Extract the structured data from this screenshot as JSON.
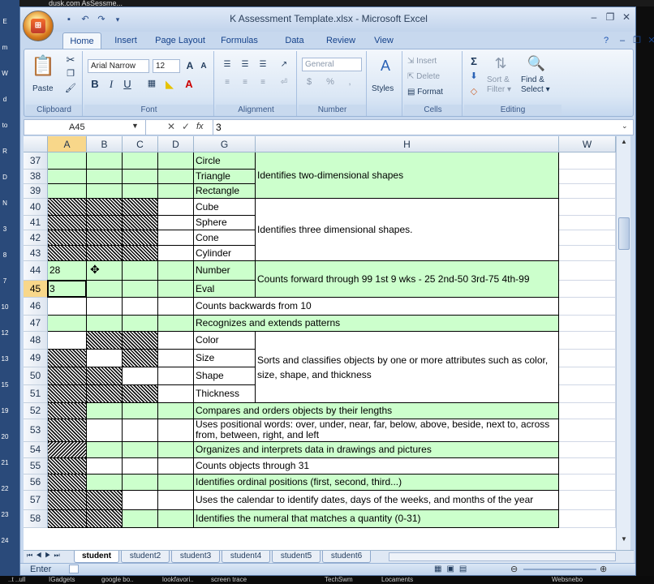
{
  "desktop": {
    "top_text": "dusk.com   AsSessme...",
    "left_labels": [
      "E",
      "m",
      "W",
      "d",
      "to",
      "R",
      "D",
      "N",
      "3",
      "8",
      "7",
      "10",
      "12",
      "13",
      "15",
      "19",
      "20",
      "21",
      "22",
      "23",
      "24"
    ],
    "bottom_items": [
      "..t ..ull",
      "IGadgets",
      "google bo..",
      "lookfavori..",
      "screen trace",
      "TechSwm",
      "Locaments",
      "Websnebo"
    ]
  },
  "window": {
    "title": "K Assessment Template.xlsx - Microsoft Excel",
    "qat_icons": [
      "save-icon",
      "undo-icon",
      "redo-icon",
      "customize-icon"
    ]
  },
  "ribbon": {
    "tabs": [
      "Home",
      "Insert",
      "Page Layout",
      "Formulas",
      "Data",
      "Review",
      "View"
    ],
    "active_tab": "Home",
    "clipboard": {
      "label": "Clipboard",
      "paste": "Paste"
    },
    "font": {
      "label": "Font",
      "name": "Arial Narrow",
      "size": "12",
      "bold": "B",
      "italic": "I",
      "underline": "U",
      "grow": "A",
      "shrink": "A"
    },
    "alignment": {
      "label": "Alignment"
    },
    "number": {
      "label": "Number",
      "format": "General",
      "currency": "$",
      "percent": "%",
      "comma": ","
    },
    "styles": {
      "label": "Styles"
    },
    "cells": {
      "label": "Cells",
      "insert": "Insert",
      "delete": "Delete",
      "format": "Format"
    },
    "editing": {
      "label": "Editing",
      "sum": "Σ",
      "sort": "Sort &",
      "filter": "Filter",
      "find": "Find &",
      "select": "Select"
    }
  },
  "formula_bar": {
    "name_box": "A45",
    "fx": "fx",
    "value": "3"
  },
  "columns": [
    "A",
    "B",
    "C",
    "D",
    "G",
    "H",
    "W"
  ],
  "selected_column": "A",
  "selected_row": "45",
  "rows": [
    "37",
    "38",
    "39",
    "40",
    "41",
    "42",
    "43",
    "44",
    "45",
    "46",
    "47",
    "48",
    "49",
    "50",
    "51",
    "52",
    "53",
    "54",
    "55",
    "56",
    "57",
    "58"
  ],
  "cells": {
    "g37": "Circle",
    "g38": "Triangle",
    "g39": "Rectangle",
    "h37": "Identifies two-dimensional shapes",
    "g40": "Cube",
    "g41": "Sphere",
    "g42": "Cone",
    "g43": "Cylinder",
    "h40": "Identifies three dimensional shapes.",
    "a44": "28",
    "a45": "3",
    "g44": "Number",
    "g45": "Eval",
    "h44": "Counts forward through 99      1st 9 wks - 25    2nd-50    3rd-75    4th-99",
    "g46": "Counts backwards from 10",
    "g47": "Recognizes and extends patterns",
    "g48": "Color",
    "g49": "Size",
    "g50": "Shape",
    "g51": "Thickness",
    "h48": "Sorts and classifies objects by one or more attributes such as color, size, shape, and thickness",
    "g52": "Compares and orders objects by their lengths",
    "g53": "Uses positional words: over, under, near, far, below, above, beside, next to, across from, between, right, and left",
    "g54": "Organizes and interprets data in drawings and pictures",
    "g55": "Counts objects through 31",
    "g56": "Identifies ordinal positions (first, second, third...)",
    "g57": "Uses the calendar to identify dates, days of the weeks, and months of the year",
    "g58": "Identifies the numeral that matches a quantity (0-31)"
  },
  "sheet_tabs": [
    "student",
    "student2",
    "student3",
    "student4",
    "student5",
    "student6"
  ],
  "active_sheet": "student",
  "status": {
    "mode": "Enter"
  }
}
